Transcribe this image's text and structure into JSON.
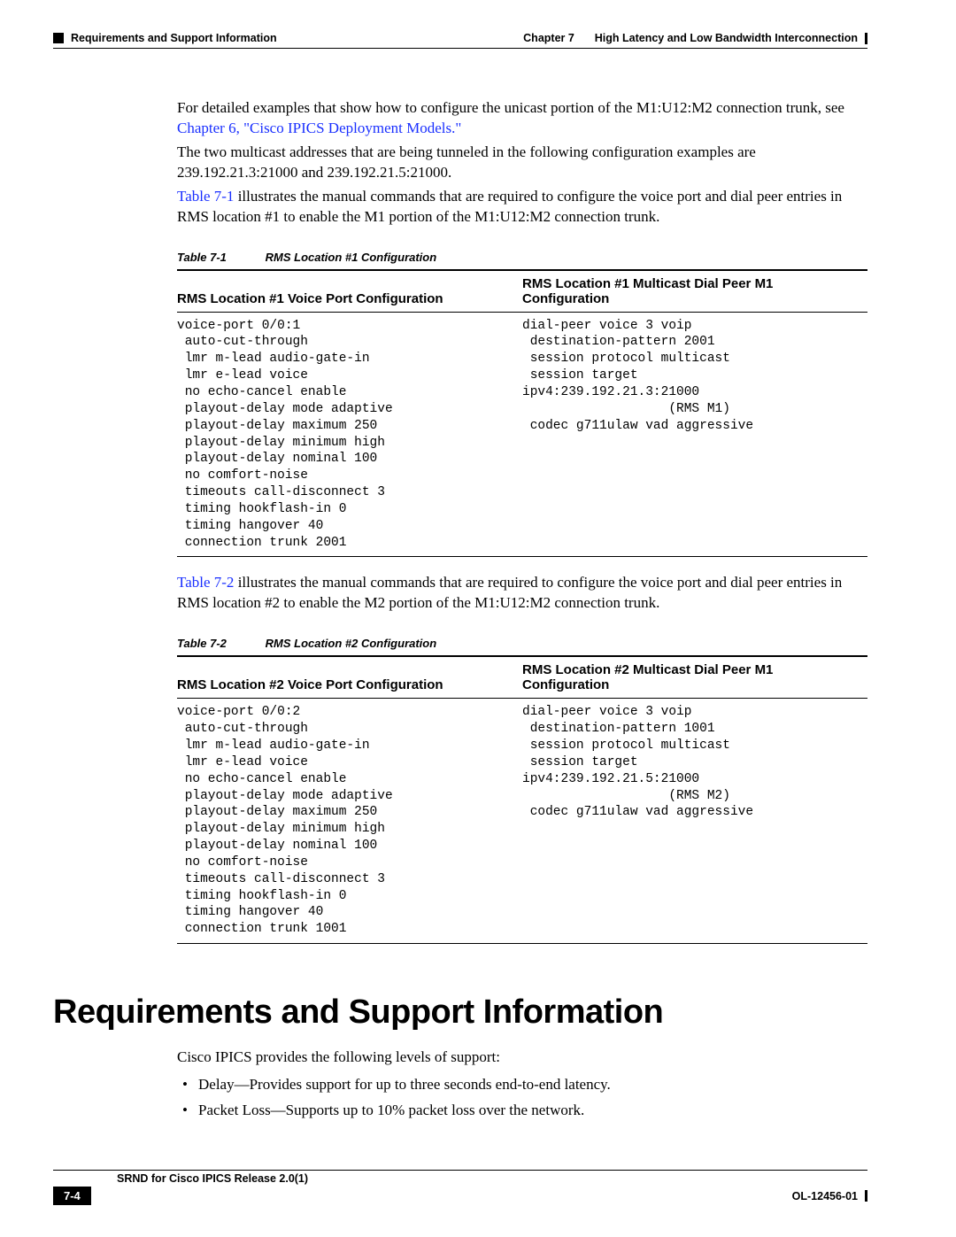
{
  "header": {
    "section_breadcrumb": "Requirements and Support Information",
    "chapter_ref": "Chapter 7",
    "chapter_title": "High Latency and Low Bandwidth Interconnection"
  },
  "body": {
    "p1a": "For detailed examples that show how to configure the unicast portion of the M1:U12:M2 connection trunk, see ",
    "p1_link": "Chapter 6, \"Cisco IPICS Deployment Models.\"",
    "p2": "The two multicast addresses that are being tunneled in the following configuration examples are 239.192.21.3:21000 and 239.192.21.5:21000.",
    "p3_link": "Table 7-1",
    "p3b": " illustrates the manual commands that are required to configure the voice port and dial peer entries in RMS location #1 to enable the M1 portion of the M1:U12:M2 connection trunk.",
    "table1": {
      "num": "Table 7-1",
      "title": "RMS Location #1 Configuration",
      "col1_header": "RMS Location #1 Voice Port Configuration",
      "col2_header": "RMS Location #1 Multicast Dial Peer M1 Configuration",
      "col1_body": "voice-port 0/0:1\n auto-cut-through\n lmr m-lead audio-gate-in\n lmr e-lead voice\n no echo-cancel enable\n playout-delay mode adaptive\n playout-delay maximum 250\n playout-delay minimum high\n playout-delay nominal 100\n no comfort-noise\n timeouts call-disconnect 3\n timing hookflash-in 0\n timing hangover 40\n connection trunk 2001",
      "col2_body": "dial-peer voice 3 voip\n destination-pattern 2001\n session protocol multicast\n session target \nipv4:239.192.21.3:21000\n                   (RMS M1)\n codec g711ulaw vad aggressive"
    },
    "p4_link": "Table 7-2",
    "p4b": " illustrates the manual commands that are required to configure the voice port and dial peer entries in RMS location #2 to enable the M2 portion of the M1:U12:M2 connection trunk.",
    "table2": {
      "num": "Table 7-2",
      "title": "RMS Location #2 Configuration",
      "col1_header": "RMS Location #2 Voice Port Configuration",
      "col2_header": "RMS Location #2 Multicast Dial Peer M1 Configuration",
      "col1_body": "voice-port 0/0:2\n auto-cut-through\n lmr m-lead audio-gate-in\n lmr e-lead voice\n no echo-cancel enable\n playout-delay mode adaptive\n playout-delay maximum 250\n playout-delay minimum high\n playout-delay nominal 100\n no comfort-noise\n timeouts call-disconnect 3\n timing hookflash-in 0\n timing hangover 40\n connection trunk 1001",
      "col2_body": "dial-peer voice 3 voip\n destination-pattern 1001\n session protocol multicast\n session target \nipv4:239.192.21.5:21000\n                   (RMS M2)\n codec g711ulaw vad aggressive"
    },
    "h1": "Requirements and Support Information",
    "p5": "Cisco IPICS provides the following levels of support:",
    "bullet1": "Delay—Provides support for up to three seconds end-to-end latency.",
    "bullet2": "Packet Loss—Supports up to 10% packet loss over the network."
  },
  "footer": {
    "doc_title": "SRND for Cisco IPICS Release 2.0(1)",
    "page_num": "7-4",
    "doc_num": "OL-12456-01"
  }
}
